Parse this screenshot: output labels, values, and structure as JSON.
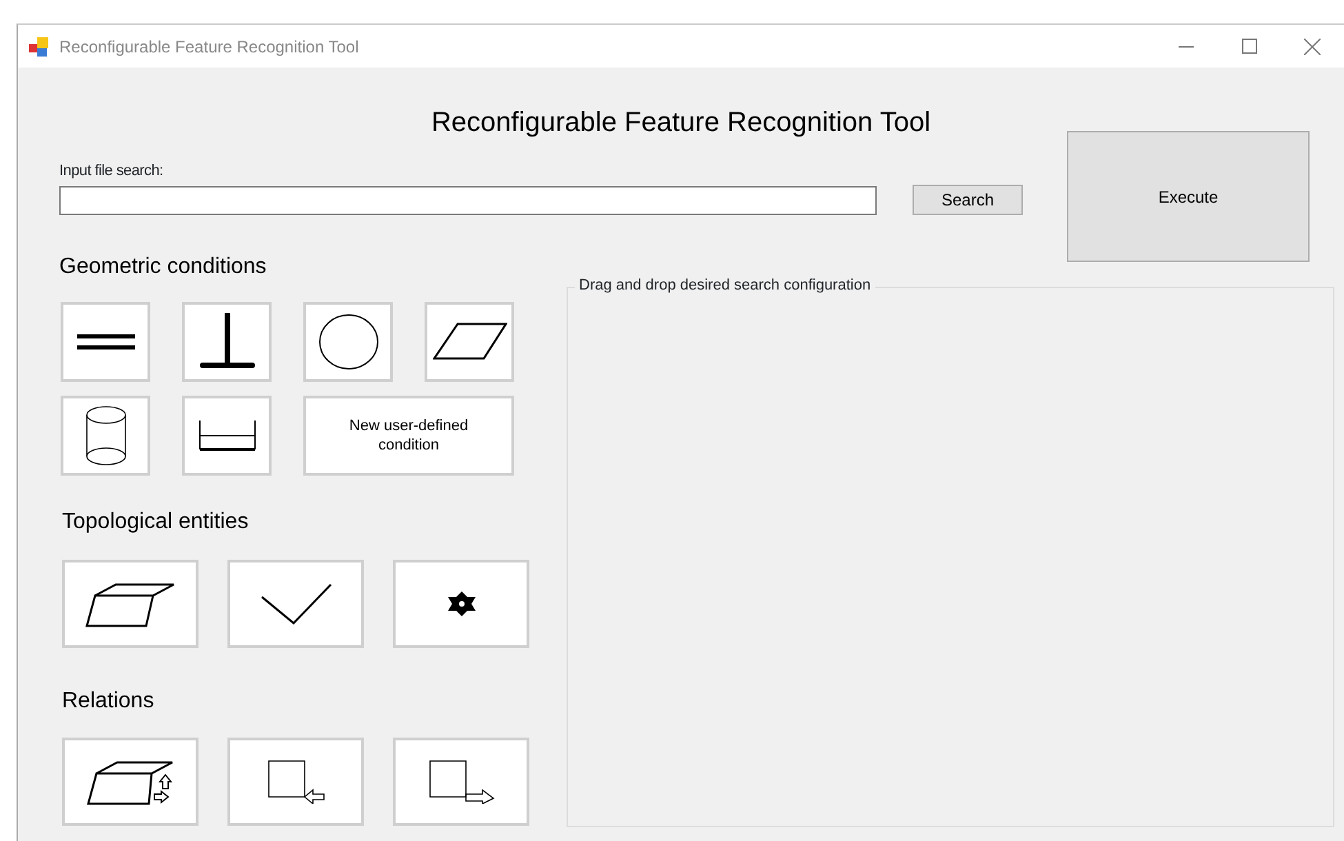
{
  "window": {
    "title": "Reconfigurable Feature Recognition Tool"
  },
  "heading": "Reconfigurable Feature Recognition Tool",
  "file_search": {
    "label": "Input file search:",
    "button": "Search"
  },
  "execute_button": "Execute",
  "sections": [
    {
      "title": "Geometric conditions",
      "tiles": [
        {
          "kind": "parallel"
        },
        {
          "kind": "perpendicular"
        },
        {
          "kind": "circle"
        },
        {
          "kind": "plane"
        },
        {
          "kind": "cylinder"
        },
        {
          "kind": "distance"
        },
        {
          "kind": "text",
          "label": "New user-defined condition"
        }
      ]
    },
    {
      "title": "Topological entities",
      "tiles": [
        {
          "kind": "face"
        },
        {
          "kind": "edge"
        },
        {
          "kind": "vertex"
        }
      ]
    },
    {
      "title": "Relations",
      "tiles": [
        {
          "kind": "adjacent"
        },
        {
          "kind": "incoming"
        },
        {
          "kind": "outgoing"
        }
      ]
    }
  ],
  "drop_area": {
    "label": "Drag and drop desired search configuration"
  }
}
